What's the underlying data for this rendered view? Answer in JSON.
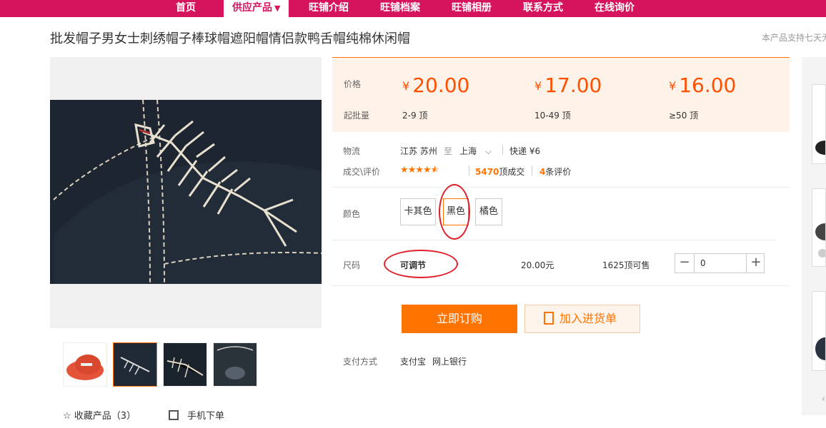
{
  "nav": {
    "items": [
      "首页",
      "供应产品",
      "旺铺介绍",
      "旺铺档案",
      "旺铺相册",
      "联系方式",
      "在线询价"
    ],
    "active_caret": "▼"
  },
  "product": {
    "title": "批发帽子男女士刺绣帽子棒球帽遮阳帽情侣款鸭舌帽纯棉休闲帽",
    "notice": "本产品支持七天无"
  },
  "price": {
    "label_price": "价格",
    "label_moq": "起批量",
    "currency": "¥",
    "tiers": [
      {
        "price": "20.00",
        "range": "2-9  顶"
      },
      {
        "price": "17.00",
        "range": "10-49  顶"
      },
      {
        "price": "16.00",
        "range": "≥50  顶"
      }
    ]
  },
  "logistics": {
    "label": "物流",
    "origin": "江苏 苏州",
    "to_word": "至",
    "destination": "上海",
    "shipping": "快递 ¥6"
  },
  "deals": {
    "label": "成交\\评价",
    "rating": 4.5,
    "sold_count": "5470",
    "sold_suffix": "顶成交",
    "review_count": "4",
    "review_suffix": "条评价"
  },
  "color": {
    "label": "颜色",
    "options": [
      "卡其色",
      "黑色",
      "橘色"
    ],
    "selected": "黑色"
  },
  "size": {
    "label": "尺码",
    "value": "可调节",
    "unit_price": "20.00元",
    "stock": "1625顶可售",
    "quantity": "0",
    "minus": "−",
    "plus": "+"
  },
  "actions": {
    "buy": "立即订购",
    "cart": "加入进货单"
  },
  "payment": {
    "label": "支付方式",
    "methods": [
      "支付宝",
      "网上银行"
    ]
  },
  "gallery": {
    "favorite_label": "收藏产品（3）",
    "mobile_label": "手机下单"
  },
  "colors": {
    "brand": "#d6145e",
    "accent": "#ff7300",
    "annotation": "#e0202a"
  }
}
